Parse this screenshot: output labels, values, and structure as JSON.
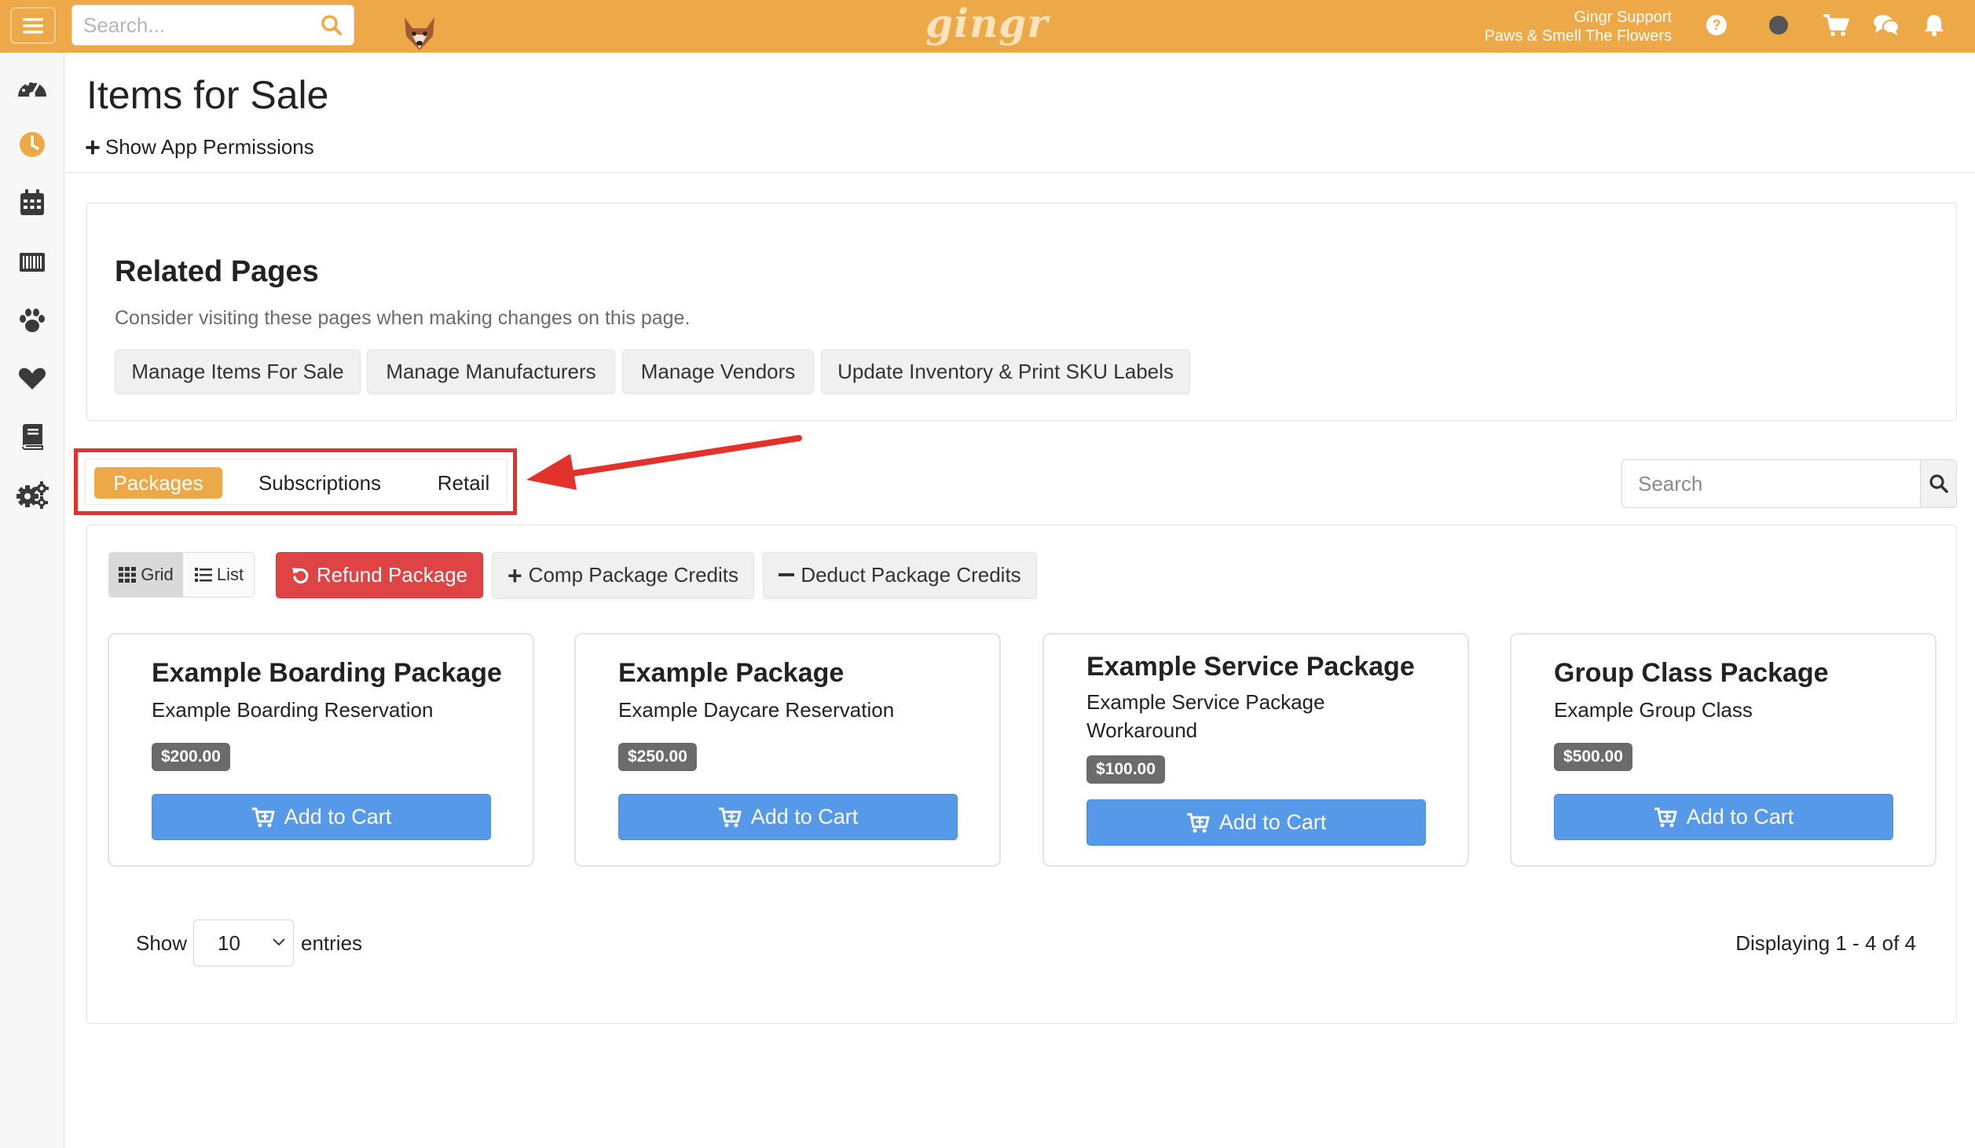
{
  "topbar": {
    "search_placeholder": "Search...",
    "logo": "gingr",
    "user_name": "Gingr Support",
    "location": "Paws & Smell The Flowers"
  },
  "page": {
    "title": "Items for Sale",
    "show_permissions": "Show App Permissions"
  },
  "related": {
    "title": "Related Pages",
    "subtitle": "Consider visiting these pages when making changes on this page.",
    "buttons": [
      "Manage Items For Sale",
      "Manage Manufacturers",
      "Manage Vendors",
      "Update Inventory & Print SKU Labels"
    ]
  },
  "tabs": [
    "Packages",
    "Subscriptions",
    "Retail"
  ],
  "list_search": {
    "placeholder": "Search"
  },
  "view_toggle": {
    "grid": "Grid",
    "list": "List"
  },
  "actions": {
    "refund": "Refund Package",
    "comp": "Comp Package Credits",
    "deduct": "Deduct Package Credits"
  },
  "packages": [
    {
      "name": "Example Boarding Package",
      "description": "Example Boarding Reservation",
      "price": "$200.00",
      "button": "Add to Cart"
    },
    {
      "name": "Example Package",
      "description": "Example Daycare Reservation",
      "price": "$250.00",
      "button": "Add to Cart"
    },
    {
      "name": "Example Service Package",
      "description": "Example Service Package Workaround",
      "price": "$100.00",
      "button": "Add to Cart"
    },
    {
      "name": "Group Class Package",
      "description": "Example Group Class",
      "price": "$500.00",
      "button": "Add to Cart"
    }
  ],
  "pagination": {
    "show": "Show",
    "entries_value": "10",
    "entries": "entries",
    "displaying": "Displaying 1 - 4 of 4"
  },
  "colors": {
    "brand_orange": "#eda948",
    "danger_red": "#e04343",
    "primary_blue": "#5599e8",
    "highlight_red": "#e3322b"
  }
}
